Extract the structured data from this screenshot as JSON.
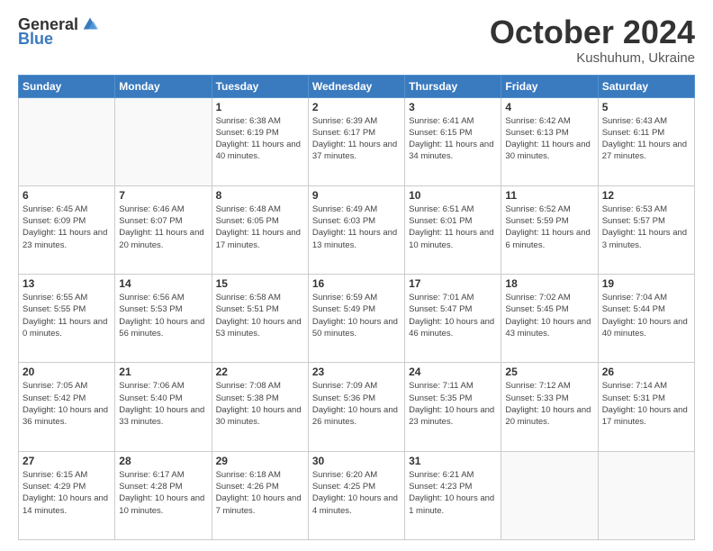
{
  "header": {
    "logo_general": "General",
    "logo_blue": "Blue",
    "month": "October 2024",
    "location": "Kushuhum, Ukraine"
  },
  "weekdays": [
    "Sunday",
    "Monday",
    "Tuesday",
    "Wednesday",
    "Thursday",
    "Friday",
    "Saturday"
  ],
  "weeks": [
    [
      {
        "day": "",
        "info": ""
      },
      {
        "day": "",
        "info": ""
      },
      {
        "day": "1",
        "info": "Sunrise: 6:38 AM\nSunset: 6:19 PM\nDaylight: 11 hours and 40 minutes."
      },
      {
        "day": "2",
        "info": "Sunrise: 6:39 AM\nSunset: 6:17 PM\nDaylight: 11 hours and 37 minutes."
      },
      {
        "day": "3",
        "info": "Sunrise: 6:41 AM\nSunset: 6:15 PM\nDaylight: 11 hours and 34 minutes."
      },
      {
        "day": "4",
        "info": "Sunrise: 6:42 AM\nSunset: 6:13 PM\nDaylight: 11 hours and 30 minutes."
      },
      {
        "day": "5",
        "info": "Sunrise: 6:43 AM\nSunset: 6:11 PM\nDaylight: 11 hours and 27 minutes."
      }
    ],
    [
      {
        "day": "6",
        "info": "Sunrise: 6:45 AM\nSunset: 6:09 PM\nDaylight: 11 hours and 23 minutes."
      },
      {
        "day": "7",
        "info": "Sunrise: 6:46 AM\nSunset: 6:07 PM\nDaylight: 11 hours and 20 minutes."
      },
      {
        "day": "8",
        "info": "Sunrise: 6:48 AM\nSunset: 6:05 PM\nDaylight: 11 hours and 17 minutes."
      },
      {
        "day": "9",
        "info": "Sunrise: 6:49 AM\nSunset: 6:03 PM\nDaylight: 11 hours and 13 minutes."
      },
      {
        "day": "10",
        "info": "Sunrise: 6:51 AM\nSunset: 6:01 PM\nDaylight: 11 hours and 10 minutes."
      },
      {
        "day": "11",
        "info": "Sunrise: 6:52 AM\nSunset: 5:59 PM\nDaylight: 11 hours and 6 minutes."
      },
      {
        "day": "12",
        "info": "Sunrise: 6:53 AM\nSunset: 5:57 PM\nDaylight: 11 hours and 3 minutes."
      }
    ],
    [
      {
        "day": "13",
        "info": "Sunrise: 6:55 AM\nSunset: 5:55 PM\nDaylight: 11 hours and 0 minutes."
      },
      {
        "day": "14",
        "info": "Sunrise: 6:56 AM\nSunset: 5:53 PM\nDaylight: 10 hours and 56 minutes."
      },
      {
        "day": "15",
        "info": "Sunrise: 6:58 AM\nSunset: 5:51 PM\nDaylight: 10 hours and 53 minutes."
      },
      {
        "day": "16",
        "info": "Sunrise: 6:59 AM\nSunset: 5:49 PM\nDaylight: 10 hours and 50 minutes."
      },
      {
        "day": "17",
        "info": "Sunrise: 7:01 AM\nSunset: 5:47 PM\nDaylight: 10 hours and 46 minutes."
      },
      {
        "day": "18",
        "info": "Sunrise: 7:02 AM\nSunset: 5:45 PM\nDaylight: 10 hours and 43 minutes."
      },
      {
        "day": "19",
        "info": "Sunrise: 7:04 AM\nSunset: 5:44 PM\nDaylight: 10 hours and 40 minutes."
      }
    ],
    [
      {
        "day": "20",
        "info": "Sunrise: 7:05 AM\nSunset: 5:42 PM\nDaylight: 10 hours and 36 minutes."
      },
      {
        "day": "21",
        "info": "Sunrise: 7:06 AM\nSunset: 5:40 PM\nDaylight: 10 hours and 33 minutes."
      },
      {
        "day": "22",
        "info": "Sunrise: 7:08 AM\nSunset: 5:38 PM\nDaylight: 10 hours and 30 minutes."
      },
      {
        "day": "23",
        "info": "Sunrise: 7:09 AM\nSunset: 5:36 PM\nDaylight: 10 hours and 26 minutes."
      },
      {
        "day": "24",
        "info": "Sunrise: 7:11 AM\nSunset: 5:35 PM\nDaylight: 10 hours and 23 minutes."
      },
      {
        "day": "25",
        "info": "Sunrise: 7:12 AM\nSunset: 5:33 PM\nDaylight: 10 hours and 20 minutes."
      },
      {
        "day": "26",
        "info": "Sunrise: 7:14 AM\nSunset: 5:31 PM\nDaylight: 10 hours and 17 minutes."
      }
    ],
    [
      {
        "day": "27",
        "info": "Sunrise: 6:15 AM\nSunset: 4:29 PM\nDaylight: 10 hours and 14 minutes."
      },
      {
        "day": "28",
        "info": "Sunrise: 6:17 AM\nSunset: 4:28 PM\nDaylight: 10 hours and 10 minutes."
      },
      {
        "day": "29",
        "info": "Sunrise: 6:18 AM\nSunset: 4:26 PM\nDaylight: 10 hours and 7 minutes."
      },
      {
        "day": "30",
        "info": "Sunrise: 6:20 AM\nSunset: 4:25 PM\nDaylight: 10 hours and 4 minutes."
      },
      {
        "day": "31",
        "info": "Sunrise: 6:21 AM\nSunset: 4:23 PM\nDaylight: 10 hours and 1 minute."
      },
      {
        "day": "",
        "info": ""
      },
      {
        "day": "",
        "info": ""
      }
    ]
  ]
}
